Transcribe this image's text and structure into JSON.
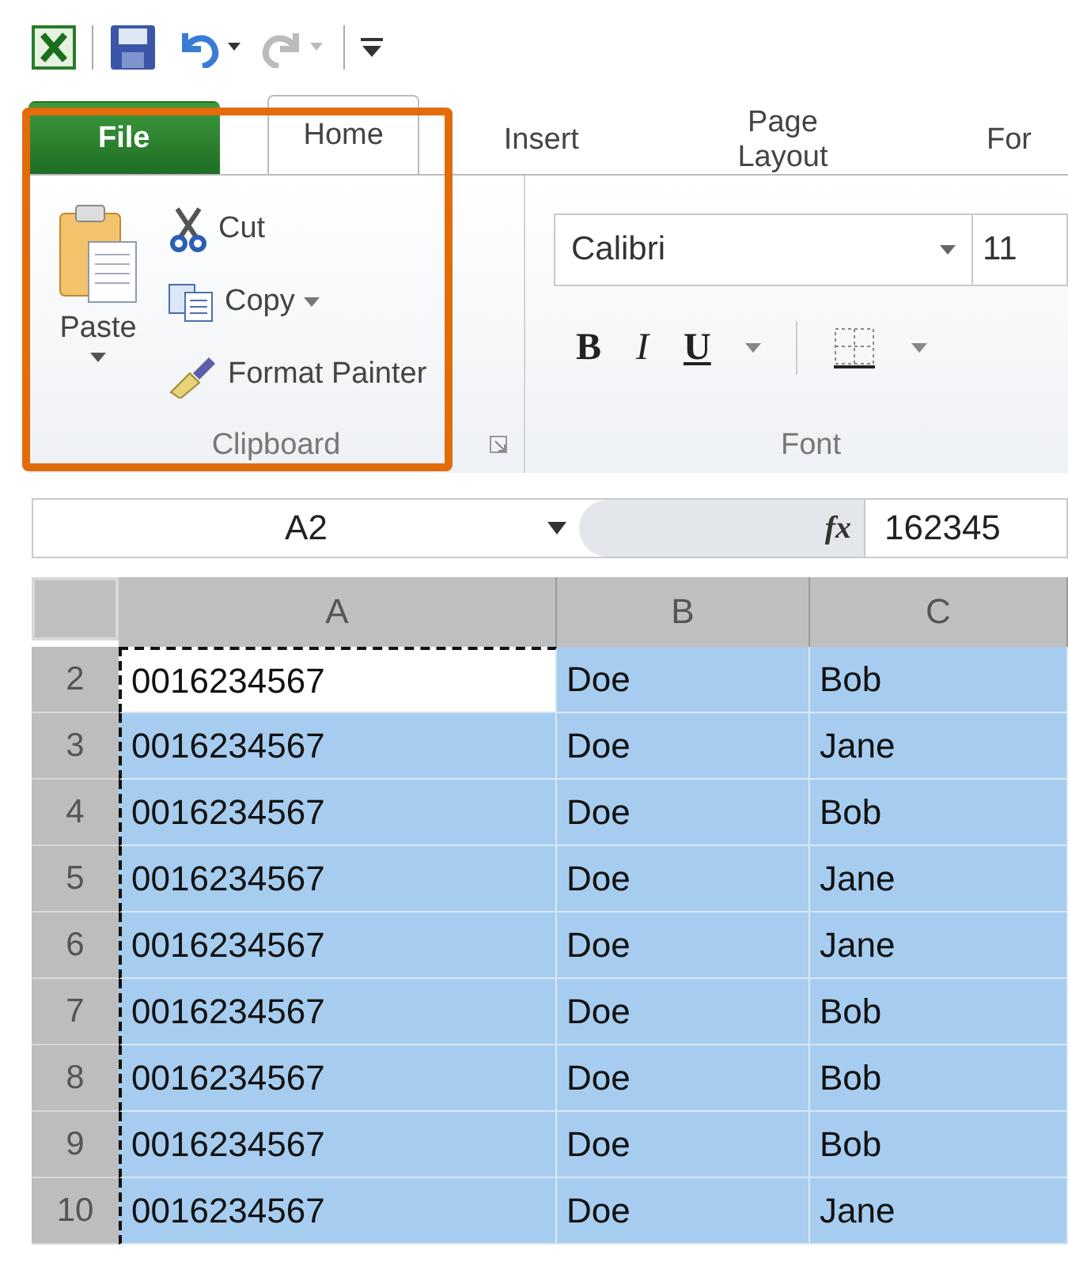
{
  "tabs": [
    {
      "label": "File",
      "kind": "file",
      "selected": false
    },
    {
      "label": "Home",
      "kind": "tab",
      "selected": true
    },
    {
      "label": "Insert",
      "kind": "tab",
      "selected": false
    },
    {
      "label": "Page Layout",
      "kind": "tab",
      "selected": false
    },
    {
      "label": "For",
      "kind": "tab",
      "selected": false
    }
  ],
  "clipboard": {
    "paste": "Paste",
    "cut": "Cut",
    "copy": "Copy",
    "format_painter": "Format Painter",
    "label": "Clipboard"
  },
  "font": {
    "name": "Calibri",
    "size": "11",
    "bold": "B",
    "italic": "I",
    "underline": "U",
    "label": "Font"
  },
  "name_box": "A2",
  "fx": "fx",
  "formula": "162345",
  "columns": [
    {
      "label": "A",
      "copied": true
    },
    {
      "label": "B",
      "copied": false
    },
    {
      "label": "C",
      "copied": false
    }
  ],
  "rows": [
    {
      "number": "2",
      "cells": [
        {
          "text": "0016234567",
          "selected": false
        },
        {
          "text": "Doe",
          "selected": true
        },
        {
          "text": "Bob",
          "selected": true
        }
      ]
    },
    {
      "number": "3",
      "cells": [
        {
          "text": "0016234567",
          "selected": true
        },
        {
          "text": "Doe",
          "selected": true
        },
        {
          "text": "Jane",
          "selected": true
        }
      ]
    },
    {
      "number": "4",
      "cells": [
        {
          "text": "0016234567",
          "selected": true
        },
        {
          "text": "Doe",
          "selected": true
        },
        {
          "text": "Bob",
          "selected": true
        }
      ]
    },
    {
      "number": "5",
      "cells": [
        {
          "text": "0016234567",
          "selected": true
        },
        {
          "text": "Doe",
          "selected": true
        },
        {
          "text": "Jane",
          "selected": true
        }
      ]
    },
    {
      "number": "6",
      "cells": [
        {
          "text": "0016234567",
          "selected": true
        },
        {
          "text": "Doe",
          "selected": true
        },
        {
          "text": "Jane",
          "selected": true
        }
      ]
    },
    {
      "number": "7",
      "cells": [
        {
          "text": "0016234567",
          "selected": true
        },
        {
          "text": "Doe",
          "selected": true
        },
        {
          "text": "Bob",
          "selected": true
        }
      ]
    },
    {
      "number": "8",
      "cells": [
        {
          "text": "0016234567",
          "selected": true
        },
        {
          "text": "Doe",
          "selected": true
        },
        {
          "text": "Bob",
          "selected": true
        }
      ]
    },
    {
      "number": "9",
      "cells": [
        {
          "text": "0016234567",
          "selected": true
        },
        {
          "text": "Doe",
          "selected": true
        },
        {
          "text": "Bob",
          "selected": true
        }
      ]
    },
    {
      "number": "10",
      "cells": [
        {
          "text": "0016234567",
          "selected": true
        },
        {
          "text": "Doe",
          "selected": true
        },
        {
          "text": "Jane",
          "selected": true
        }
      ]
    }
  ]
}
